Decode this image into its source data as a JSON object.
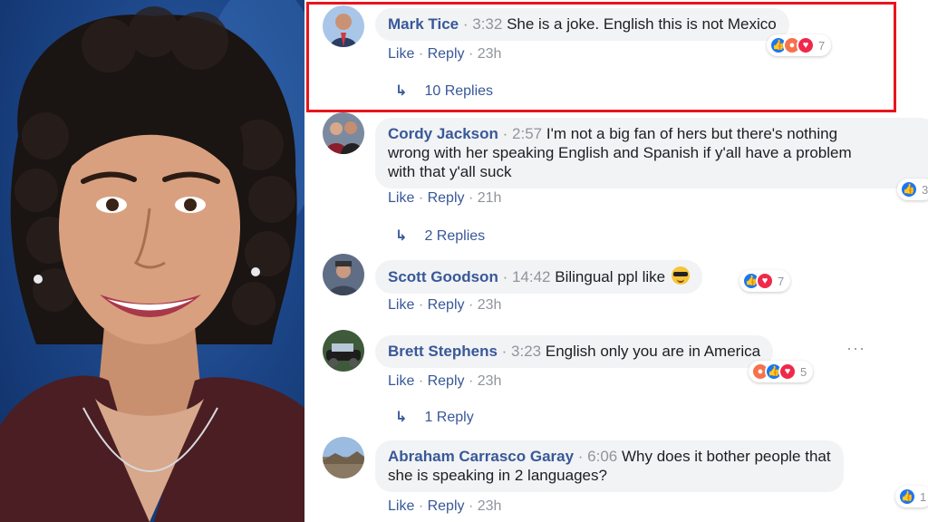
{
  "photo": {
    "icon": "portrait-photo"
  },
  "colors": {
    "author": "#385898",
    "meta": "#90949c",
    "bubble": "#f2f3f5",
    "highlight": "#e8151b",
    "like": "#1877f2",
    "love": "#f0284a"
  },
  "actions": {
    "like": "Like",
    "reply": "Reply",
    "sep": "·"
  },
  "comments": [
    {
      "author": "Mark Tice",
      "time": "3:32",
      "text": "She is a joke. English this is not Mexico",
      "age": "23h",
      "reactions": [
        "like",
        "angry",
        "love"
      ],
      "reaction_count": "7",
      "replies": "10 Replies",
      "highlighted": true
    },
    {
      "author": "Cordy Jackson",
      "time": "2:57",
      "text_line1": "I'm not a big fan of hers but there's nothing",
      "text_line2": "wrong with her speaking English and Spanish if y'all have a problem",
      "text_line3": "with that y'all suck",
      "age": "21h",
      "reactions": [
        "like"
      ],
      "reaction_count": "3",
      "replies": "2 Replies"
    },
    {
      "author": "Scott Goodson",
      "time": "14:42",
      "text": "Bilingual ppl like",
      "emoji": "sunglasses-emoji",
      "age": "23h",
      "reactions": [
        "like",
        "love"
      ],
      "reaction_count": "7"
    },
    {
      "author": "Brett Stephens",
      "time": "3:23",
      "text": "English only you are in America",
      "age": "23h",
      "reactions": [
        "angry",
        "like",
        "love"
      ],
      "reaction_count": "5",
      "replies": "1 Reply",
      "more": "···"
    },
    {
      "author": "Abraham Carrasco Garay",
      "time": "6:06",
      "text_line1": "Why does it bother people that",
      "text_line2": "she is speaking in 2 languages?",
      "age": "23h",
      "reactions": [
        "like"
      ],
      "reaction_count": "1"
    }
  ]
}
